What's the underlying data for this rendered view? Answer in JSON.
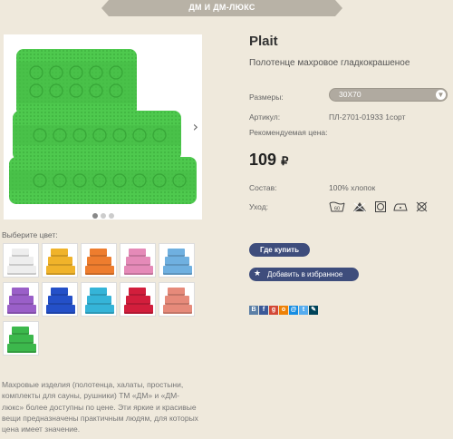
{
  "header": {
    "ribbon": "ДМ И ДМ-ЛЮКС"
  },
  "product": {
    "title": "Plait",
    "subtitle": "Полотенце махровое гладкокрашеное",
    "size_label": "Размеры:",
    "size_value": "30X70",
    "article_label": "Артикул:",
    "article_value": "ПЛ-2701-01933 1сорт",
    "price_label": "Рекомендуемая цена:",
    "price": "109",
    "currency": "₽",
    "composition_label": "Состав:",
    "composition_value": "100% хлопок",
    "care_label": "Уход:",
    "care_icons": [
      "wash-60-icon",
      "no-bleach-icon",
      "tumble-dry-icon",
      "iron-icon",
      "no-dryclean-icon"
    ],
    "care_wash_temp": "60",
    "main_color": "#4ec94e"
  },
  "gallery": {
    "next_glyph": "›",
    "dots": 3,
    "active_dot": 0
  },
  "buttons": {
    "buy": "Где купить",
    "favorite": "Добавить в избранное",
    "star_glyph": "★"
  },
  "share": [
    {
      "icon": "vk-icon",
      "letter": "В",
      "color": "#5b7fa6"
    },
    {
      "icon": "facebook-icon",
      "letter": "f",
      "color": "#3b5998"
    },
    {
      "icon": "google-plus-icon",
      "letter": "g",
      "color": "#d34836"
    },
    {
      "icon": "odnoklassniki-icon",
      "letter": "о",
      "color": "#ee8208"
    },
    {
      "icon": "mailru-icon",
      "letter": "@",
      "color": "#168de2"
    },
    {
      "icon": "twitter-icon",
      "letter": "t",
      "color": "#55acee"
    },
    {
      "icon": "livejournal-icon",
      "letter": "✎",
      "color": "#004359"
    }
  ],
  "color_section": {
    "label": "Выберите цвет:",
    "swatches": [
      {
        "name": "white",
        "color": "#eeeeee"
      },
      {
        "name": "yellow",
        "color": "#f0b32a"
      },
      {
        "name": "orange",
        "color": "#ee7d2e"
      },
      {
        "name": "pink",
        "color": "#e58ab8"
      },
      {
        "name": "light-blue",
        "color": "#6fb0e0"
      },
      {
        "name": "purple",
        "color": "#9a5fc8"
      },
      {
        "name": "blue",
        "color": "#2450c8"
      },
      {
        "name": "turquoise",
        "color": "#35b4d8"
      },
      {
        "name": "crimson",
        "color": "#d21e3c"
      },
      {
        "name": "salmon",
        "color": "#e68a7a"
      },
      {
        "name": "green",
        "color": "#3cb84c"
      }
    ]
  },
  "description": "Махровые изделия (полотенца, халаты, простыни, комплекты для сауны, рушники) ТМ «ДМ» и «ДМ-люкс» более доступны по цене. Эти яркие и красивые вещи предназначены практичным людям, для которых цена имеет значение."
}
